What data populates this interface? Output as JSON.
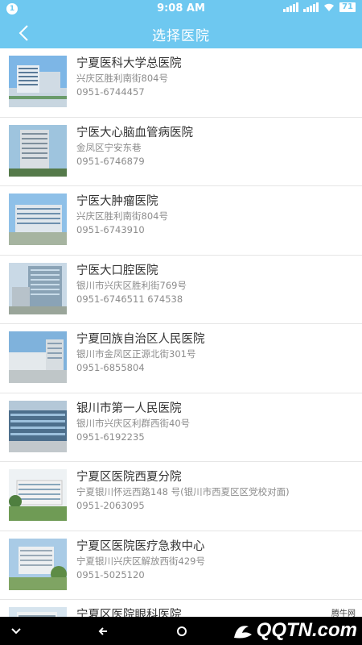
{
  "status_bar": {
    "notification_count": "1",
    "time": "9:08 AM",
    "network_speed": "0K/s",
    "battery": "71"
  },
  "header": {
    "title": "选择医院",
    "back_icon": "chevron-left-icon"
  },
  "hospitals": [
    {
      "name": "宁夏医科大学总医院",
      "address": "兴庆区胜利南街804号",
      "phone": "0951-6744457"
    },
    {
      "name": "宁医大心脑血管病医院",
      "address": "金凤区宁安东巷",
      "phone": "0951-6746879"
    },
    {
      "name": "宁医大肿瘤医院",
      "address": "兴庆区胜利南街804号",
      "phone": "0951-6743910"
    },
    {
      "name": "宁医大口腔医院",
      "address": "银川市兴庆区胜利街769号",
      "phone": "0951-6746511  674538"
    },
    {
      "name": "宁夏回族自治区人民医院",
      "address": "银川市金凤区正源北街301号",
      "phone": "0951-6855804"
    },
    {
      "name": "银川市第一人民医院",
      "address": "银川市兴庆区利群西街40号",
      "phone": "0951-6192235"
    },
    {
      "name": "宁夏区医院西夏分院",
      "address": "宁夏银川怀远西路148 号(银川市西夏区区党校对面)",
      "phone": "0951-2063095"
    },
    {
      "name": "宁夏区医院医疗急救中心",
      "address": "宁夏银川兴庆区解放西街429号",
      "phone": "0951-5025120"
    },
    {
      "name": "宁夏区医院眼科医院",
      "address": "",
      "phone": ""
    }
  ],
  "watermark": {
    "brand": "QQTN.com",
    "sub": "腾牛网"
  },
  "colors": {
    "accent": "#6ec8f0",
    "text_primary": "#333333",
    "text_secondary": "#8c8c8c"
  }
}
